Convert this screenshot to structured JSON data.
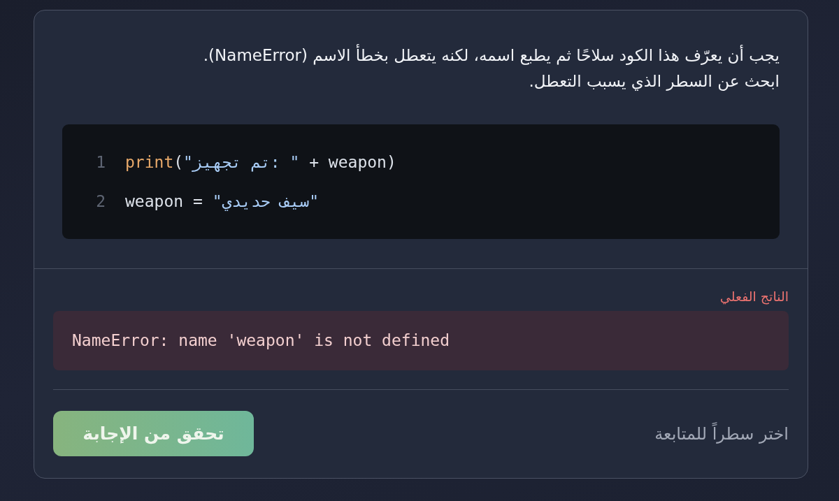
{
  "prompt": "يجب أن يعرّف هذا الكود سلاحًا ثم يطبع اسمه، لكنه يتعطل بخطأ الاسم (NameError).\nابحث عن السطر الذي يسبب التعطل.",
  "code": {
    "lines": [
      {
        "number": "1",
        "selected": false,
        "text": "print(\"تم تجهيز: \" + weapon)"
      },
      {
        "number": "2",
        "selected": false,
        "text": "weapon = \"سيف حديدي\""
      }
    ]
  },
  "output": {
    "label": "الناتج الفعلي",
    "text": "NameError: name 'weapon' is not defined"
  },
  "footer": {
    "hint": "اختر سطراً للمتابعة",
    "button": {
      "label": "تحقق من الإجابة",
      "disabled": true
    }
  }
}
